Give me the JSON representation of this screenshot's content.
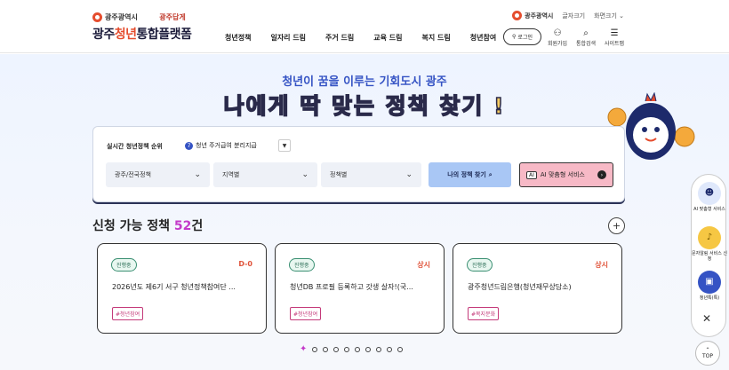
{
  "header": {
    "city_name": "광주광역시",
    "site_title_a": "광주",
    "site_title_b": "청년",
    "site_title_c": "통합플랫폼",
    "slogan": "광주답게",
    "gnb": [
      "청년정책",
      "일자리 드림",
      "주거 드림",
      "교육 드림",
      "복지 드림",
      "청년참여"
    ],
    "topbar": {
      "city": "광주광역시",
      "font_size": "글자크기",
      "zoom": "화면크기"
    },
    "login": "로그인",
    "utils": [
      {
        "label": "회원가입",
        "icon": "user-add-icon",
        "glyph": "⚇"
      },
      {
        "label": "통합검색",
        "icon": "search-icon",
        "glyph": "⌕"
      },
      {
        "label": "사이트맵",
        "icon": "menu-icon",
        "glyph": "☰"
      }
    ]
  },
  "hero": {
    "subtitle": "청년이 꿈을 이루는 기회도시 광주",
    "title_a": "나에게 ",
    "title_b": "딱",
    "title_c": " 맞는 ",
    "title_d": "정책",
    "title_e": " 찾기 !"
  },
  "search": {
    "realtime_label": "실시간 청년정책 순위",
    "rank_number": "7",
    "rank_text": "청년 주거급여 분리지급",
    "selects": [
      {
        "value": "광주/전국정책"
      },
      {
        "value": "지역별"
      },
      {
        "value": "정책별"
      }
    ],
    "find_button": "나의 정책 찾기",
    "ai_button": "AI 맞춤형 서비스",
    "ai_badge": "AI"
  },
  "policies": {
    "title": "신청 가능 정책 ",
    "count": "52",
    "unit": "건",
    "cards": [
      {
        "status": "진행중",
        "dday": "D-0",
        "title": "2026년도 제6기 서구 청년정책참여단 ...",
        "tag": "#청년참여"
      },
      {
        "status": "진행중",
        "dday": "상시",
        "title": "청년DB 프로필 등록하고 갓생 살자!(국...",
        "tag": "#청년참여"
      },
      {
        "status": "진행중",
        "dday": "상시",
        "title": "광주청년드림은행(청년재무상담소)",
        "tag": "#복지문화"
      }
    ],
    "pages": 10
  },
  "quick_menu": {
    "items": [
      {
        "label": "AI 맞춤형 서비스",
        "icon": "robot-icon"
      },
      {
        "label": "문자알림 서비스 신청",
        "icon": "bell-icon"
      },
      {
        "label": "청년톡(톡)",
        "icon": "chat-icon"
      }
    ],
    "top": "TOP"
  }
}
